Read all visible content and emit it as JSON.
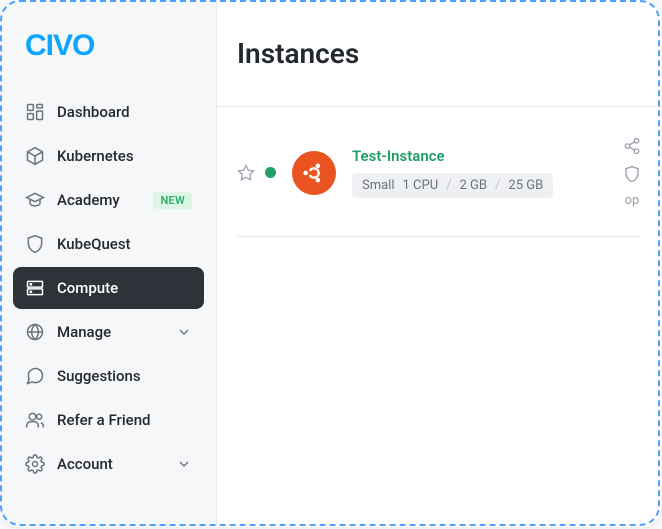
{
  "brand": "CIVO",
  "sidebar": {
    "items": [
      {
        "label": "Dashboard"
      },
      {
        "label": "Kubernetes"
      },
      {
        "label": "Academy",
        "badge": "NEW"
      },
      {
        "label": "KubeQuest"
      },
      {
        "label": "Compute"
      },
      {
        "label": "Manage"
      },
      {
        "label": "Suggestions"
      },
      {
        "label": "Refer a Friend"
      },
      {
        "label": "Account"
      }
    ]
  },
  "main": {
    "title": "Instances",
    "instance": {
      "name": "Test-Instance",
      "size": "Small",
      "cpu": "1 CPU",
      "ram": "2 GB",
      "disk": "25 GB",
      "op_label": "op"
    }
  },
  "colors": {
    "accent": "#0ea5ff",
    "active_bg": "#2e333a",
    "status_ok": "#22a06b",
    "link_green": "#1f9d6b",
    "ubuntu": "#E95420"
  }
}
